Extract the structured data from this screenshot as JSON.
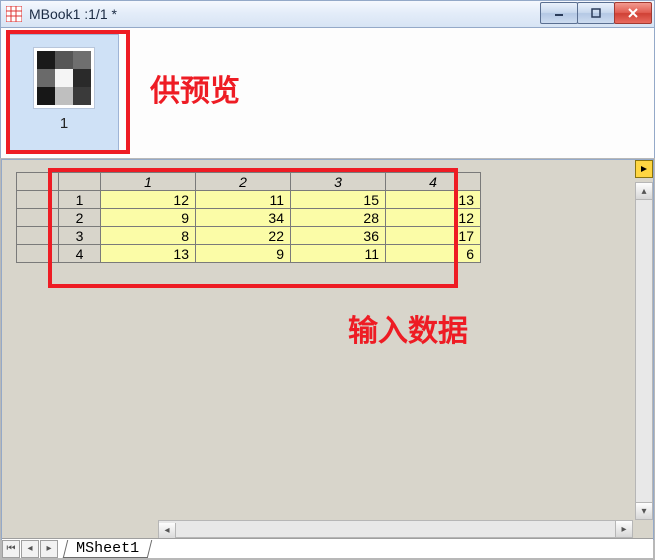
{
  "titlebar": {
    "title": "MBook1 :1/1  *"
  },
  "preview": {
    "thumb_label": "1"
  },
  "annotations": {
    "preview_label": "供预览",
    "data_label": "输入数据"
  },
  "sheet": {
    "col_headers": [
      "1",
      "2",
      "3",
      "4"
    ],
    "row_headers": [
      "1",
      "2",
      "3",
      "4"
    ],
    "rows": [
      [
        "12",
        "11",
        "15",
        "13"
      ],
      [
        "9",
        "34",
        "28",
        "12"
      ],
      [
        "8",
        "22",
        "36",
        "17"
      ],
      [
        "13",
        "9",
        "11",
        "6"
      ]
    ]
  },
  "tabs": {
    "active": "MSheet1"
  }
}
